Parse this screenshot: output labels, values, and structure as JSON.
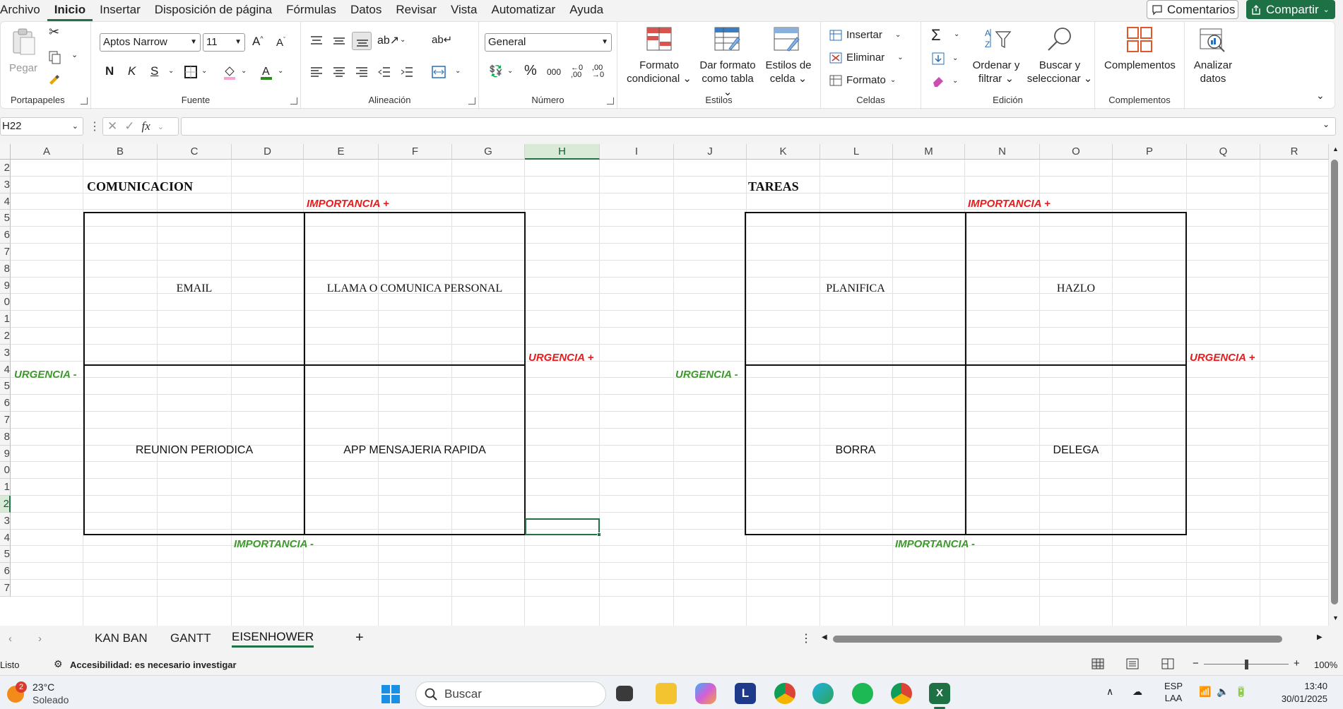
{
  "menu": {
    "items": [
      "Archivo",
      "Inicio",
      "Insertar",
      "Disposición de página",
      "Fórmulas",
      "Datos",
      "Revisar",
      "Vista",
      "Automatizar",
      "Ayuda"
    ],
    "active_index": 1,
    "comments_label": "Comentarios",
    "share_label": "Compartir"
  },
  "ribbon": {
    "clipboard": {
      "label": "Portapapeles",
      "paste": "Pegar"
    },
    "font": {
      "label": "Fuente",
      "font_name": "Aptos Narrow",
      "font_size": "11",
      "bold": "N",
      "italic": "K",
      "underline": "S"
    },
    "alignment": {
      "label": "Alineación"
    },
    "number": {
      "label": "Número",
      "format": "General",
      "percent": "%",
      "thousands": "000"
    },
    "styles": {
      "label": "Estilos",
      "conditional": [
        "Formato",
        "condicional ⌄"
      ],
      "table": [
        "Dar formato",
        "como tabla ⌄"
      ],
      "cell": [
        "Estilos de",
        "celda ⌄"
      ]
    },
    "cells": {
      "label": "Celdas",
      "insert": "Insertar",
      "delete": "Eliminar",
      "format": "Formato"
    },
    "editing": {
      "label": "Edición",
      "sort": [
        "Ordenar y",
        "filtrar ⌄"
      ],
      "find": [
        "Buscar y",
        "seleccionar ⌄"
      ]
    },
    "addins": {
      "label": "Complementos",
      "button": "Complementos"
    },
    "analyze": {
      "button": [
        "Analizar",
        "datos"
      ]
    }
  },
  "formula_bar": {
    "name_box": "H22",
    "fx": "fx",
    "value": ""
  },
  "sheet": {
    "columns": [
      "A",
      "B",
      "C",
      "D",
      "E",
      "F",
      "G",
      "H",
      "I",
      "J",
      "K",
      "L",
      "M",
      "N",
      "O",
      "P",
      "Q",
      "R"
    ],
    "selected_column": "H",
    "rows": [
      "2",
      "3",
      "4",
      "5",
      "6",
      "7",
      "8",
      "9",
      "0",
      "1",
      "2",
      "3",
      "4",
      "5",
      "6",
      "7",
      "8",
      "9",
      "0",
      "1",
      "2",
      "3",
      "4",
      "5",
      "6",
      "7"
    ],
    "selected_row_index": 20,
    "matrix_left": {
      "title": "COMUNICACION",
      "top_left": "EMAIL",
      "top_right": "LLAMA O COMUNICA PERSONAL",
      "bottom_left": "REUNION PERIODICA",
      "bottom_right": "APP MENSAJERIA RAPIDA",
      "importance_plus": "IMPORTANCIA +",
      "importance_minus": "IMPORTANCIA -",
      "urgency_plus": "URGENCIA +",
      "urgency_minus": "URGENCIA -"
    },
    "matrix_right": {
      "title": "TAREAS",
      "top_left": "PLANIFICA",
      "top_right": "HAZLO",
      "bottom_left": "BORRA",
      "bottom_right": "DELEGA",
      "importance_plus": "IMPORTANCIA +",
      "importance_minus": "IMPORTANCIA -",
      "urgency_plus": "URGENCIA +",
      "urgency_minus": "URGENCIA -"
    }
  },
  "tabs": {
    "items": [
      "KAN BAN",
      "GANTT",
      "EISENHOWER"
    ],
    "active_index": 2,
    "add": "+"
  },
  "status": {
    "ready": "Listo",
    "accessibility": "Accesibilidad: es necesario investigar",
    "zoom": "100%"
  },
  "taskbar": {
    "weather_temp": "23°C",
    "weather_desc": "Soleado",
    "weather_badge": "2",
    "search_placeholder": "Buscar",
    "lang_top": "ESP",
    "lang_bottom": "LAA",
    "time": "13:40",
    "date": "30/01/2025"
  },
  "colors": {
    "accent": "#217346",
    "red_label": "#e81c1c",
    "green_label": "#3c9a2a"
  }
}
